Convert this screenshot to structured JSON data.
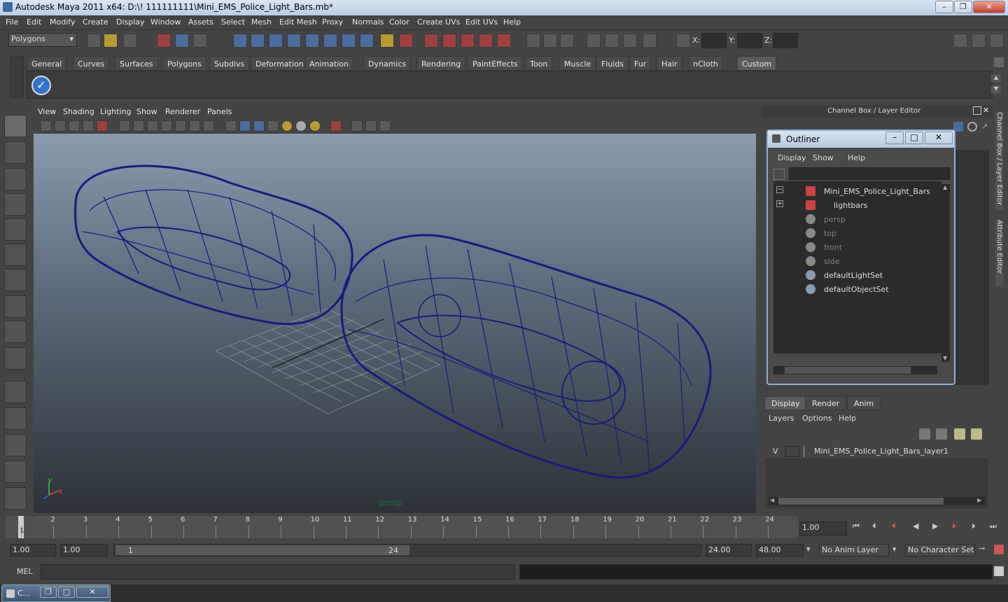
{
  "window": {
    "title": "Autodesk Maya 2011 x64: D:\\! 111111111\\Mini_EMS_Police_Light_Bars.mb*"
  },
  "menu": [
    "File",
    "Edit",
    "Modify",
    "Create",
    "Display",
    "Window",
    "Assets",
    "Select",
    "Mesh",
    "Edit Mesh",
    "Proxy",
    "Normals",
    "Color",
    "Create UVs",
    "Edit UVs",
    "Help"
  ],
  "status_line": {
    "mode": "Polygons",
    "x_label": "X:",
    "y_label": "Y:",
    "z_label": "Z:"
  },
  "shelf_tabs": [
    "General",
    "Curves",
    "Surfaces",
    "Polygons",
    "Subdivs",
    "Deformation",
    "Animation",
    "Dynamics",
    "Rendering",
    "PaintEffects",
    "Toon",
    "Muscle",
    "Fluids",
    "Fur",
    "Hair",
    "nCloth",
    "Custom"
  ],
  "active_shelf": "Custom",
  "panel_menu": [
    "View",
    "Shading",
    "Lighting",
    "Show",
    "Renderer",
    "Panels"
  ],
  "viewport": {
    "camera_label": "persp",
    "axis_y": "y",
    "axis_x": "x"
  },
  "channel_box": {
    "title": "Channel Box / Layer Editor"
  },
  "outliner": {
    "title": "Outliner",
    "menu": [
      "Display",
      "Show",
      "Help"
    ],
    "items": [
      {
        "label": "Mini_EMS_Police_Light_Bars",
        "dim": false,
        "expander": "−"
      },
      {
        "label": "lightbars",
        "dim": false,
        "expander": "+"
      },
      {
        "label": "persp",
        "dim": true,
        "expander": ""
      },
      {
        "label": "top",
        "dim": true,
        "expander": ""
      },
      {
        "label": "front",
        "dim": true,
        "expander": ""
      },
      {
        "label": "side",
        "dim": true,
        "expander": ""
      },
      {
        "label": "defaultLightSet",
        "dim": false,
        "expander": ""
      },
      {
        "label": "defaultObjectSet",
        "dim": false,
        "expander": ""
      }
    ]
  },
  "layer_editor": {
    "tabs": [
      "Display",
      "Render",
      "Anim"
    ],
    "menu": [
      "Layers",
      "Options",
      "Help"
    ],
    "layer": {
      "visibility": "V",
      "name": "Mini_EMS_Police_Light_Bars_layer1"
    }
  },
  "side_tabs": {
    "channel": "Channel Box / Layer Editor",
    "attribute": "Attribute Editor"
  },
  "timeline": {
    "ticks": [
      "1",
      "2",
      "3",
      "4",
      "5",
      "6",
      "7",
      "8",
      "9",
      "10",
      "11",
      "12",
      "13",
      "14",
      "15",
      "16",
      "17",
      "18",
      "19",
      "20",
      "21",
      "22",
      "23",
      "24"
    ],
    "current_frame": "1",
    "current_time": "1.00"
  },
  "range": {
    "start": "1.00",
    "playback_start": "1.00",
    "slider_start": "1",
    "slider_end": "24",
    "playback_end": "24.00",
    "end": "48.00",
    "anim_layer": "No Anim Layer",
    "character_set": "No Character Set"
  },
  "command_line": {
    "label": "MEL"
  },
  "taskbar": {
    "item": "C..."
  }
}
